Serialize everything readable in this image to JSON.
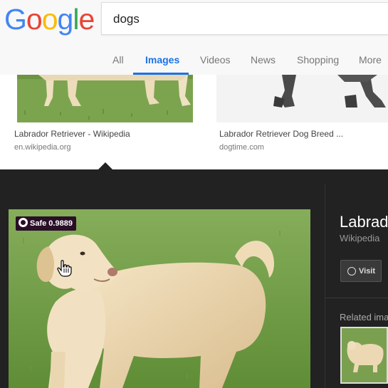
{
  "header": {
    "logo_letters": [
      {
        "ch": "G",
        "color": "#4285F4"
      },
      {
        "ch": "o",
        "color": "#EA4335"
      },
      {
        "ch": "o",
        "color": "#FBBC05"
      },
      {
        "ch": "g",
        "color": "#4285F4"
      },
      {
        "ch": "l",
        "color": "#34A853"
      },
      {
        "ch": "e",
        "color": "#EA4335"
      }
    ],
    "search_value": "dogs"
  },
  "tabs": [
    "All",
    "Images",
    "Videos",
    "News",
    "Shopping",
    "More"
  ],
  "active_tab": "Images",
  "results": [
    {
      "title": "Labrador Retriever - Wikipedia",
      "source": "en.wikipedia.org"
    },
    {
      "title": "Labrador Retriever Dog Breed ...",
      "source": "dogtime.com"
    }
  ],
  "preview": {
    "safe_badge": "Safe 0.9889",
    "title": "Labrad",
    "source": "Wikipedia",
    "visit_label": "Visit",
    "related_label": "Related ima",
    "icons": {
      "badge": "safe-shield-icon",
      "visit": "globe-icon",
      "cursor": "hand-cursor-icon"
    }
  },
  "colors": {
    "accent": "#1a73e8",
    "panel_bg": "#222222",
    "badge_bg": "#2a0f28"
  }
}
